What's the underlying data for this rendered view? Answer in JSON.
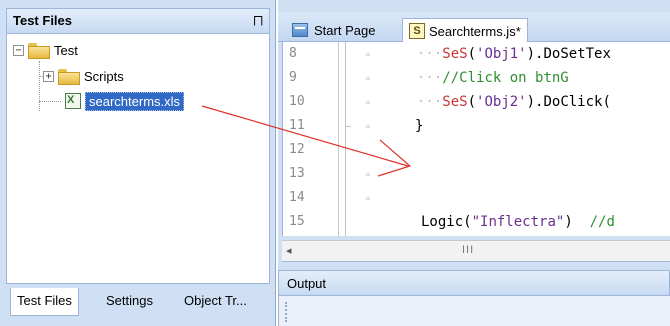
{
  "left_panel": {
    "title": "Test Files",
    "pin_glyph": "⨅",
    "tree": {
      "root": {
        "label": "Test",
        "expander": "−"
      },
      "scripts": {
        "label": "Scripts",
        "expander": "+"
      },
      "file": {
        "label": "searchterms.xls"
      }
    },
    "bottom_tabs": [
      "Test Files",
      "Settings",
      "Object Tr..."
    ]
  },
  "editor_tabs": [
    {
      "label": "Start Page"
    },
    {
      "label": "Searchterms.js*"
    }
  ],
  "editor": {
    "line_numbers": [
      "8",
      "9",
      "10",
      "11",
      "12",
      "13",
      "14",
      "15"
    ],
    "whitespace_mark": "»",
    "lines": {
      "l8_fn": "SeS",
      "l8_paren": "(",
      "l8_str": "'Obj1'",
      "l8_rest": ").DoSetTex",
      "l9_cmt": "//Click on btnG",
      "l10_fn": "SeS",
      "l10_paren": "(",
      "l10_str": "'Obj2'",
      "l10_rest": ").DoClick(",
      "l11_brace": "}",
      "l15_fn": "Logic",
      "l15_paren": "(",
      "l15_str": "\"Inflectra\"",
      "l15_close": ")",
      "l15_cmt": "//d"
    },
    "indent_dots": "···"
  },
  "scrollbar": {
    "left_arrow": "◂",
    "thumb_grip": "III"
  },
  "output": {
    "title": "Output"
  },
  "colors": {
    "selection": "#3169c6",
    "annotation_arrow": "#e0302a",
    "function_name": "#cc3333",
    "string": "#6a2f8f",
    "comment": "#2f8f2f"
  }
}
